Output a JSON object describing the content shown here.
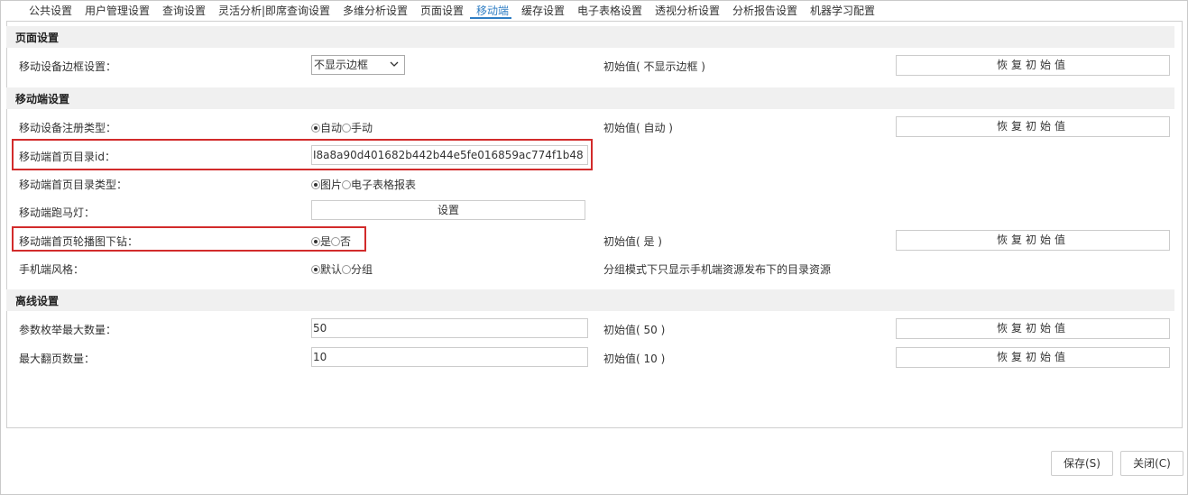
{
  "tabs": [
    {
      "label": "公共设置"
    },
    {
      "label": "用户管理设置"
    },
    {
      "label": "查询设置"
    },
    {
      "label": "灵活分析|即席查询设置"
    },
    {
      "label": "多维分析设置"
    },
    {
      "label": "页面设置"
    },
    {
      "label": "移动端"
    },
    {
      "label": "缓存设置"
    },
    {
      "label": "电子表格设置"
    },
    {
      "label": "透视分析设置"
    },
    {
      "label": "分析报告设置"
    },
    {
      "label": "机器学习配置"
    }
  ],
  "active_tab": "移动端",
  "sections": {
    "page": {
      "title": "页面设置"
    },
    "mobile": {
      "title": "移动端设置"
    },
    "offline": {
      "title": "离线设置"
    }
  },
  "restore_label": "恢复初始值",
  "rows": {
    "border": {
      "label": "移动设备边框设置：",
      "select_value": "不显示边框",
      "init": "初始值( 不显示边框 )"
    },
    "register": {
      "label": "移动设备注册类型：",
      "opt1": "自动",
      "opt2": "手动",
      "selected": "自动",
      "init": "初始值( 自动 )"
    },
    "catalog_id": {
      "label": "移动端首页目录id：",
      "value": "I8a8a90d401682b442b44e5fe016859ac774f1b48"
    },
    "catalog_type": {
      "label": "移动端首页目录类型：",
      "opt1": "图片",
      "opt2": "电子表格报表",
      "selected": "图片"
    },
    "marquee": {
      "label": "移动端跑马灯：",
      "button": "设置"
    },
    "carousel": {
      "label": "移动端首页轮播图下钻：",
      "opt1": "是",
      "opt2": "否",
      "selected": "是",
      "init": "初始值( 是 )"
    },
    "style": {
      "label": "手机端风格：",
      "opt1": "默认",
      "opt2": "分组",
      "selected": "默认",
      "note": "分组模式下只显示手机端资源发布下的目录资源"
    },
    "param_max": {
      "label": "参数枚举最大数量：",
      "value": "50",
      "init": "初始值( 50 )"
    },
    "max_pages": {
      "label": "最大翻页数量：",
      "value": "10",
      "init": "初始值( 10 )"
    }
  },
  "footer": {
    "save": "保存(S)",
    "close": "关闭(C)"
  },
  "colors": {
    "accent": "#2f7ec4",
    "highlight": "#d22b2b"
  }
}
